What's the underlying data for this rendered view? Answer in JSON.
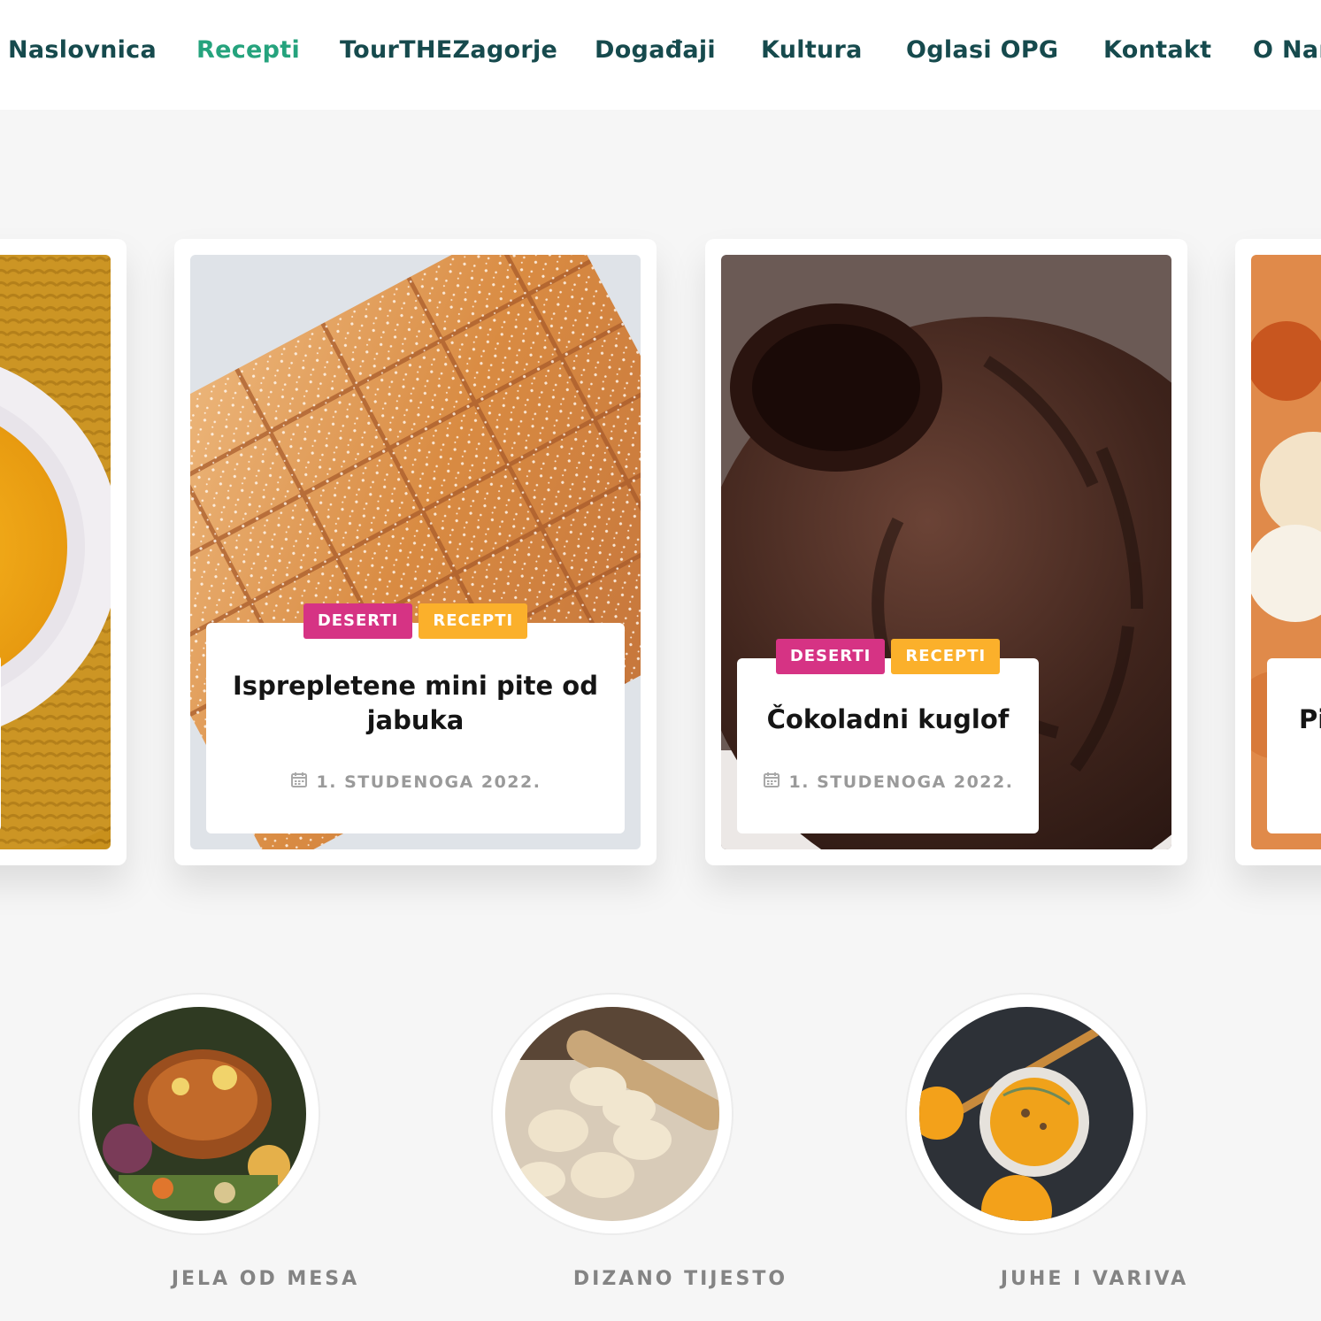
{
  "nav": {
    "items": [
      "Naslovnica",
      "Recepti",
      "TourTHEZagorje",
      "Događaji",
      "Kultura",
      "Oglasi OPG",
      "Kontakt",
      "O Nama"
    ],
    "active": "Recepti"
  },
  "colors": {
    "nav_text": "#164a4d",
    "nav_active": "#25a37d",
    "tag_desserts": "#d63384",
    "tag_recipes": "#fbb02b",
    "background": "#f6f6f6"
  },
  "cards": [
    {
      "title": "",
      "tags": [],
      "date": "",
      "image": "soup-bowl-photo"
    },
    {
      "title": "Isprepletene mini pite od jabuka",
      "tags": [
        "DESERTI",
        "RECEPTI"
      ],
      "date": "1. STUDENOGA 2022.",
      "image": "apple-lattice-pie-photo"
    },
    {
      "title": "Čokoladni kuglof",
      "tags": [
        "DESERTI",
        "RECEPTI"
      ],
      "date": "1. STUDENOGA 2022.",
      "image": "chocolate-bundt-cake-photo"
    },
    {
      "title": "Pi",
      "tags": [],
      "date": "",
      "image": "pizza-photo"
    }
  ],
  "categories": [
    {
      "label": "JELA OD MESA",
      "image": "roast-chicken-photo"
    },
    {
      "label": "DIZANO TIJESTO",
      "image": "dough-balls-photo"
    },
    {
      "label": "JUHE I VARIVA",
      "image": "pumpkin-soup-photo"
    }
  ],
  "icons": {
    "date": "calendar-icon"
  }
}
